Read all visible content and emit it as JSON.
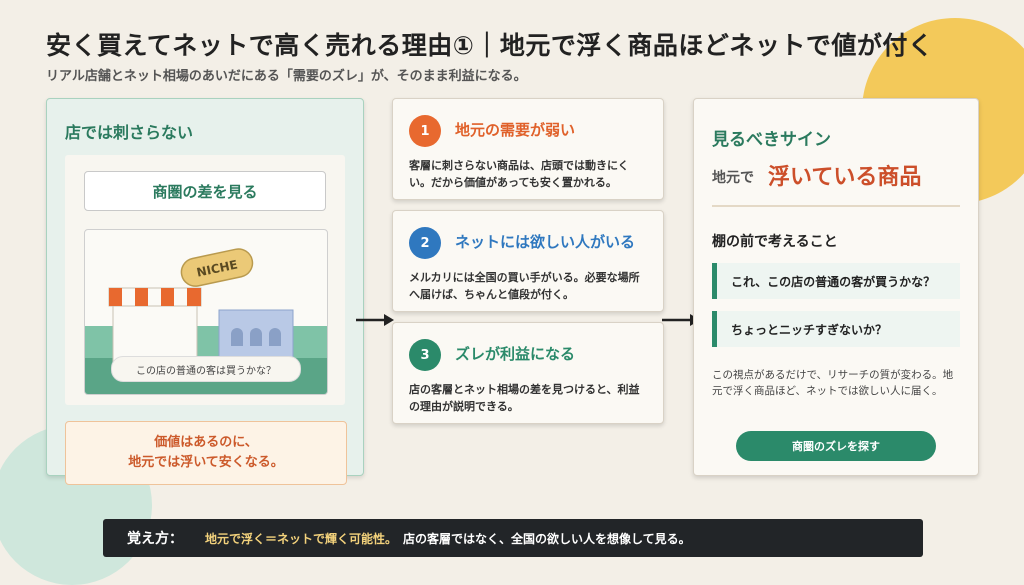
{
  "title": "安く買えてネットで高く売れる理由①｜地元で浮く商品ほどネットで値が付く",
  "subtitle": "リアル店舗とネット相場のあいだにある「需要のズレ」が、そのまま利益になる。",
  "left": {
    "heading": "店では刺さらない",
    "badge": "商圏の差を見る",
    "illustration": {
      "sign": "NICHE",
      "caption": "この店の普通の客は買うかな？"
    },
    "note_line1": "価値はあるのに、",
    "note_line2": "地元では浮いて安くなる。"
  },
  "steps": [
    {
      "num": "1",
      "title": "地元の需要が弱い",
      "body": "客層に刺さらない商品は、店頭では動きにくい。だから価値があっても安く置かれる。",
      "color": "#e8692f"
    },
    {
      "num": "2",
      "title": "ネットには欲しい人がいる",
      "body": "メルカリには全国の買い手がいる。必要な場所へ届けば、ちゃんと値段が付く。",
      "color": "#2f78bf"
    },
    {
      "num": "3",
      "title": "ズレが利益になる",
      "body": "店の客層とネット相場の差を見つけると、利益の理由が説明できる。",
      "color": "#2b8a6a"
    }
  ],
  "right": {
    "heading": "見るべきサイン",
    "sub_small": "地元で",
    "sub_big": "浮いている商品",
    "think_heading": "棚の前で考えること",
    "questions": [
      "これ、この店の普通の客が買うかな？",
      "ちょっとニッチすぎないか？"
    ],
    "note": "この視点があるだけで、リサーチの質が変わる。地元で浮く商品ほど、ネットでは欲しい人に届く。",
    "button": "商圏のズレを探す"
  },
  "bottom": {
    "label": "覚え方：",
    "highlight": "地元で浮く＝ネットで輝く可能性。",
    "text": "店の客層ではなく、全国の欲しい人を想像して見る。"
  },
  "colors": {
    "green": "#2b8a6a",
    "orange": "#e8692f",
    "blue": "#2f78bf",
    "red": "#cc4f2a",
    "yellow": "#f3c95a"
  }
}
